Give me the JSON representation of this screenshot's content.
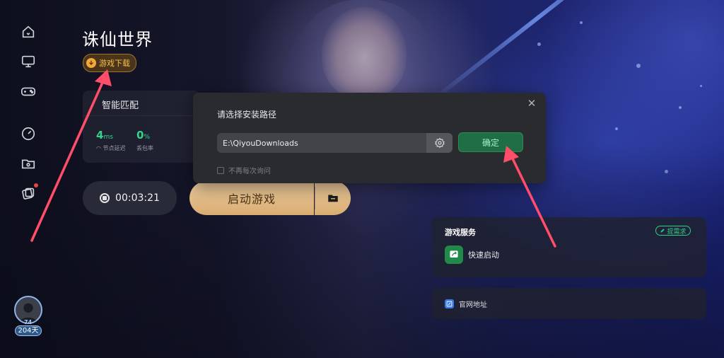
{
  "game": {
    "title": "诛仙世界",
    "download_badge": "游戏下载"
  },
  "sidebar": {
    "items": [
      {
        "icon": "home-icon"
      },
      {
        "icon": "monitor-icon"
      },
      {
        "icon": "gamepad-icon"
      },
      {
        "icon": "speedometer-icon"
      },
      {
        "icon": "folder-icon"
      },
      {
        "icon": "cards-icon",
        "has_notification": true
      }
    ]
  },
  "user": {
    "avatar_level": "74",
    "days_badge": "204天"
  },
  "stats": {
    "mode_label": "智能匹配",
    "latency_value": "4",
    "latency_unit": "ms",
    "latency_label": "节点延迟",
    "packet_loss_value": "0",
    "packet_loss_unit": "%",
    "packet_loss_label": "丢包率"
  },
  "timer": {
    "value": "00:03:21"
  },
  "start_button": {
    "label": "启动游戏"
  },
  "install_dialog": {
    "title": "请选择安装路径",
    "path_value": "E:\\QiyouDownloads",
    "confirm_label": "确定",
    "dont_ask_label": "不再每次询问",
    "close_symbol": "✕"
  },
  "services": {
    "title": "游戏服务",
    "request_button": "提需求",
    "quick_launch_label": "快速启动",
    "official_site_label": "官网地址"
  },
  "colors": {
    "accent_green": "#35d48a",
    "start_gold": "#d8ac72",
    "arrow_red": "#ff4d6a"
  }
}
